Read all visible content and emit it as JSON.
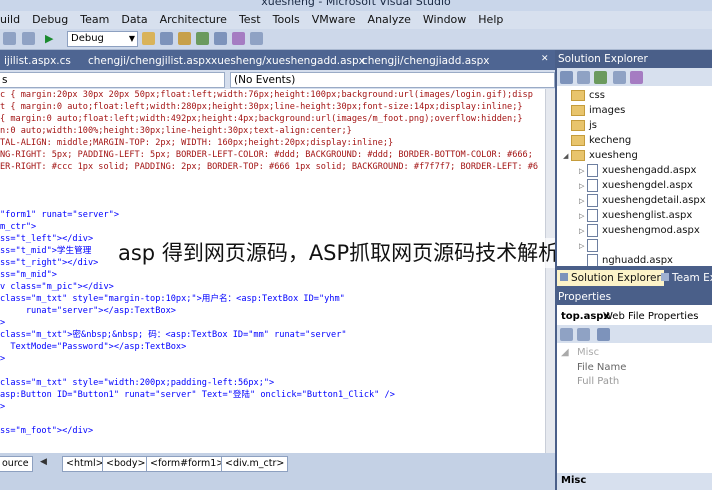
{
  "window": {
    "title": "xuesheng - Microsoft Visual Studio"
  },
  "menu": [
    "uild",
    "Debug",
    "Team",
    "Data",
    "Architecture",
    "Test",
    "Tools",
    "VMware",
    "Analyze",
    "Window",
    "Help"
  ],
  "toolbar": {
    "config": "Debug"
  },
  "tabs": [
    {
      "label": "ijilist.aspx.cs",
      "active": false
    },
    {
      "label": "chengji/chengjilist.aspx",
      "active": false
    },
    {
      "label": "xuesheng/xueshengadd.aspx",
      "active": false
    },
    {
      "label": "chengji/chengjiadd.aspx",
      "active": false
    }
  ],
  "navbar": {
    "left": "s",
    "right": "(No Events)"
  },
  "code_lines": [
    [
      {
        "t": "c { margin:20px 30px 20px 50px;float:left;width:76px;height:100px;background:url(images/login.gif);disp",
        "c": "#a31515"
      }
    ],
    [
      {
        "t": "t { margin:0 auto;float:left;width:280px;height:30px;line-height:30px;font-size:14px;display:inline;}",
        "c": "#a31515"
      }
    ],
    [
      {
        "t": "{ margin:0 auto;float:left;width:492px;height:4px;background:url(images/m_foot.png);overflow:hidden;}",
        "c": "#a31515"
      }
    ],
    [
      {
        "t": "n:0 auto;width:100%;height:30px;line-height:30px;text-align:center;}",
        "c": "#a31515"
      }
    ],
    [
      {
        "t": "TAL-ALIGN: middle;MARGIN-TOP: 2px; WIDTH: 160px;height:20px;display:inline;}",
        "c": "#a31515"
      }
    ],
    [
      {
        "t": "NG-RIGHT: 5px; PADDING-LEFT: 5px; BORDER-LEFT-COLOR: #ddd; BACKGROUND: #ddd; BORDER-BOTTOM-COLOR: #666;",
        "c": "#a31515"
      }
    ],
    [
      {
        "t": "ER-RIGHT: #ccc 1px solid; PADDING: 2px; BORDER-TOP: #666 1px solid; BACKGROUND: #f7f7f7; BORDER-LEFT: #6",
        "c": "#a31515"
      }
    ],
    [
      {
        "t": "",
        "c": "#000"
      }
    ],
    [
      {
        "t": "",
        "c": "#000"
      }
    ],
    [
      {
        "t": "",
        "c": "#000"
      }
    ],
    [
      {
        "t": "\"form1\" runat=\"server\">",
        "c": "#0000ff"
      }
    ],
    [
      {
        "t": "m_ctr\">",
        "c": "#0000ff"
      }
    ],
    [
      {
        "t": "ss=\"t_left\"></div>",
        "c": "#0000ff"
      }
    ],
    [
      {
        "t": "ss=\"t_mid\">学生管理",
        "c": "#0000ff"
      }
    ],
    [
      {
        "t": "ss=\"t_right\"></div>",
        "c": "#0000ff"
      }
    ],
    [
      {
        "t": "ss=\"m_mid\">",
        "c": "#0000ff"
      }
    ],
    [
      {
        "t": "v class=\"m_pic\"></div>",
        "c": "#0000ff"
      }
    ],
    [
      {
        "t": "class=\"m_txt\" style=\"margin-top:10px;\">用户名：<asp:TextBox ID=\"yhm\"",
        "c": "#0000ff"
      }
    ],
    [
      {
        "t": "     runat=\"server\"></asp:TextBox>",
        "c": "#0000ff"
      }
    ],
    [
      {
        "t": ">",
        "c": "#0000ff"
      }
    ],
    [
      {
        "t": "class=\"m_txt\">密&nbsp;&nbsp; 码：<asp:TextBox ID=\"mm\" runat=\"server\"",
        "c": "#0000ff"
      }
    ],
    [
      {
        "t": "  TextMode=\"Password\"></asp:TextBox>",
        "c": "#0000ff"
      }
    ],
    [
      {
        "t": ">",
        "c": "#0000ff"
      }
    ],
    [
      {
        "t": "",
        "c": "#000"
      }
    ],
    [
      {
        "t": "class=\"m_txt\" style=\"width:200px;padding-left:56px;\">",
        "c": "#0000ff"
      }
    ],
    [
      {
        "t": "asp:Button ID=\"Button1\" runat=\"server\" Text=\"登陆\" onclick=\"Button1_Click\" />",
        "c": "#0000ff"
      }
    ],
    [
      {
        "t": ">",
        "c": "#0000ff"
      }
    ],
    [
      {
        "t": "",
        "c": "#000"
      }
    ],
    [
      {
        "t": "ss=\"m_foot\"></div>",
        "c": "#0000ff"
      }
    ],
    [
      {
        "t": "",
        "c": "#000"
      }
    ],
    [
      {
        "t": "",
        "c": "#000"
      }
    ]
  ],
  "watermark": "asp 得到网页源码，ASP抓取网页源码技术解析",
  "bottom": {
    "view": "ource",
    "crumbs": [
      "<html>",
      "<body>",
      "<form#form1>",
      "<div.m_ctr>"
    ]
  },
  "solution_explorer": {
    "title": "Solution Explorer",
    "items": [
      {
        "label": "css",
        "type": "folder",
        "level": 1,
        "exp": ""
      },
      {
        "label": "images",
        "type": "folder",
        "level": 1,
        "exp": ""
      },
      {
        "label": "js",
        "type": "folder",
        "level": 1,
        "exp": ""
      },
      {
        "label": "kecheng",
        "type": "folder",
        "level": 1,
        "exp": ""
      },
      {
        "label": "xuesheng",
        "type": "folder",
        "level": 1,
        "exp": "◢"
      },
      {
        "label": "xueshengadd.aspx",
        "type": "file",
        "level": 2,
        "exp": "▷"
      },
      {
        "label": "xueshengdel.aspx",
        "type": "file",
        "level": 2,
        "exp": "▷"
      },
      {
        "label": "xueshengdetail.aspx",
        "type": "file",
        "level": 2,
        "exp": "▷"
      },
      {
        "label": "xuesheng​list.aspx",
        "type": "file",
        "level": 2,
        "exp": "▷"
      },
      {
        "label": "xueshengmod.aspx",
        "type": "file",
        "level": 2,
        "exp": "▷"
      },
      {
        "label": "",
        "type": "file",
        "level": 2,
        "exp": "▷"
      },
      {
        "label": "nghuadd.aspx",
        "type": "file",
        "level": 2,
        "exp": ""
      }
    ],
    "tabs": [
      "Solution Explorer",
      "Team Exp"
    ]
  },
  "properties": {
    "title": "Properties",
    "object": "top.aspx",
    "object_type": "Web File Properties",
    "category": "Misc",
    "rows": [
      "File Name",
      "Full Path"
    ],
    "footer": "Misc"
  }
}
